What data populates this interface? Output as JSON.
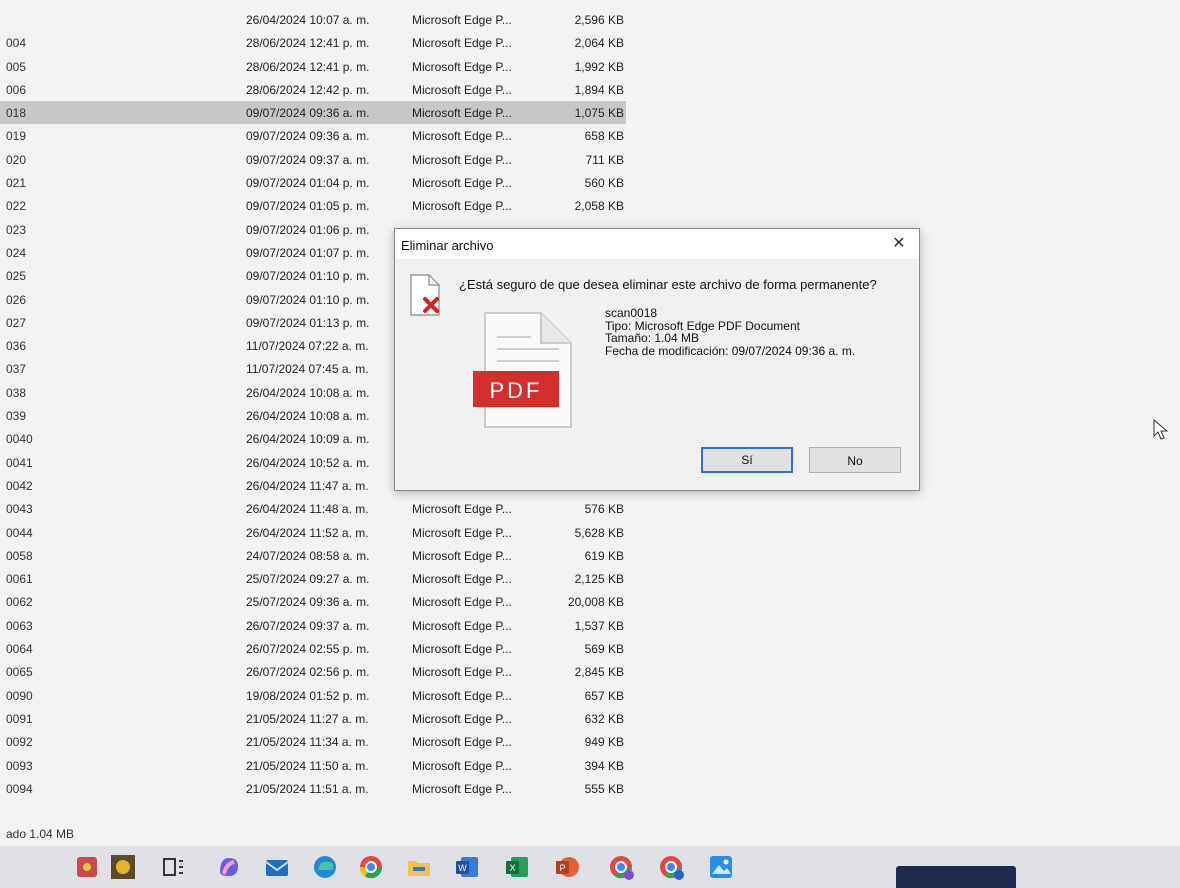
{
  "dialog": {
    "title": "Eliminar archivo",
    "close_glyph": "✕",
    "question": "¿Está seguro de que desea eliminar este archivo de forma permanente?",
    "file_name": "scan0018",
    "file_type": "Tipo: Microsoft Edge PDF Document",
    "file_size": "Tamaño: 1.04 MB",
    "file_modified": "Fecha de modificación: 09/07/2024 09:36 a. m.",
    "pdf_icon_label": "PDF",
    "yes_label": "Sí",
    "no_label": "No"
  },
  "files": [
    {
      "name": "",
      "date": "26/04/2024 10:07 a. m.",
      "type": "Microsoft Edge P...",
      "size": "2,596 KB"
    },
    {
      "name": "004",
      "date": "28/06/2024 12:41 p. m.",
      "type": "Microsoft Edge P...",
      "size": "2,064 KB"
    },
    {
      "name": "005",
      "date": "28/06/2024 12:41 p. m.",
      "type": "Microsoft Edge P...",
      "size": "1,992 KB"
    },
    {
      "name": "006",
      "date": "28/06/2024 12:42 p. m.",
      "type": "Microsoft Edge P...",
      "size": "1,894 KB"
    },
    {
      "name": "018",
      "date": "09/07/2024 09:36 a. m.",
      "type": "Microsoft Edge P...",
      "size": "1,075 KB",
      "selected": true
    },
    {
      "name": "019",
      "date": "09/07/2024 09:36 a. m.",
      "type": "Microsoft Edge P...",
      "size": "658 KB"
    },
    {
      "name": "020",
      "date": "09/07/2024 09:37 a. m.",
      "type": "Microsoft Edge P...",
      "size": "711 KB"
    },
    {
      "name": "021",
      "date": "09/07/2024 01:04 p. m.",
      "type": "Microsoft Edge P...",
      "size": "560 KB"
    },
    {
      "name": "022",
      "date": "09/07/2024 01:05 p. m.",
      "type": "Microsoft Edge P...",
      "size": "2,058 KB"
    },
    {
      "name": "023",
      "date": "09/07/2024 01:06 p. m.",
      "type": "",
      "size": ""
    },
    {
      "name": "024",
      "date": "09/07/2024 01:07 p. m.",
      "type": "",
      "size": ""
    },
    {
      "name": "025",
      "date": "09/07/2024 01:10 p. m.",
      "type": "",
      "size": ""
    },
    {
      "name": "026",
      "date": "09/07/2024 01:10 p. m.",
      "type": "",
      "size": ""
    },
    {
      "name": "027",
      "date": "09/07/2024 01:13 p. m.",
      "type": "",
      "size": ""
    },
    {
      "name": "036",
      "date": "11/07/2024 07:22 a. m.",
      "type": "",
      "size": ""
    },
    {
      "name": "037",
      "date": "11/07/2024 07:45 a. m.",
      "type": "",
      "size": ""
    },
    {
      "name": "038",
      "date": "26/04/2024 10:08 a. m.",
      "type": "",
      "size": ""
    },
    {
      "name": "039",
      "date": "26/04/2024 10:08 a. m.",
      "type": "",
      "size": ""
    },
    {
      "name": "0040",
      "date": "26/04/2024 10:09 a. m.",
      "type": "",
      "size": ""
    },
    {
      "name": "0041",
      "date": "26/04/2024 10:52 a. m.",
      "type": "",
      "size": ""
    },
    {
      "name": "0042",
      "date": "26/04/2024 11:47 a. m.",
      "type": "",
      "size": ""
    },
    {
      "name": "0043",
      "date": "26/04/2024 11:48 a. m.",
      "type": "Microsoft Edge P...",
      "size": "576 KB"
    },
    {
      "name": "0044",
      "date": "26/04/2024 11:52 a. m.",
      "type": "Microsoft Edge P...",
      "size": "5,628 KB"
    },
    {
      "name": "0058",
      "date": "24/07/2024 08:58 a. m.",
      "type": "Microsoft Edge P...",
      "size": "619 KB"
    },
    {
      "name": "0061",
      "date": "25/07/2024 09:27 a. m.",
      "type": "Microsoft Edge P...",
      "size": "2,125 KB"
    },
    {
      "name": "0062",
      "date": "25/07/2024 09:36 a. m.",
      "type": "Microsoft Edge P...",
      "size": "20,008 KB"
    },
    {
      "name": "0063",
      "date": "26/07/2024 09:37 a. m.",
      "type": "Microsoft Edge P...",
      "size": "1,537 KB"
    },
    {
      "name": "0064",
      "date": "26/07/2024 02:55 p. m.",
      "type": "Microsoft Edge P...",
      "size": "569 KB"
    },
    {
      "name": "0065",
      "date": "26/07/2024 02:56 p. m.",
      "type": "Microsoft Edge P...",
      "size": "2,845 KB"
    },
    {
      "name": "0090",
      "date": "19/08/2024 01:52 p. m.",
      "type": "Microsoft Edge P...",
      "size": "657 KB"
    },
    {
      "name": "0091",
      "date": "21/05/2024 11:27 a. m.",
      "type": "Microsoft Edge P...",
      "size": "632 KB"
    },
    {
      "name": "0092",
      "date": "21/05/2024 11:34 a. m.",
      "type": "Microsoft Edge P...",
      "size": "949 KB"
    },
    {
      "name": "0093",
      "date": "21/05/2024 11:50 a. m.",
      "type": "Microsoft Edge P...",
      "size": "394 KB"
    },
    {
      "name": "0094",
      "date": "21/05/2024 11:51 a. m.",
      "type": "Microsoft Edge P...",
      "size": "555 KB"
    }
  ],
  "status_bar": {
    "text": "ado 1.04 MB"
  },
  "taskbar": {
    "icons": [
      "chip-icon",
      "sun-icon",
      "task-view-icon",
      "copilot-icon",
      "mail-icon",
      "edge-icon",
      "chrome-icon",
      "file-explorer-icon",
      "word-icon",
      "excel-icon",
      "powerpoint-icon",
      "chrome-profile-icon",
      "chrome-profile-icon",
      "photos-icon"
    ]
  },
  "colors": {
    "selection": "#c7c7c7",
    "pdf_red": "#d32f2f",
    "delete_red": "#d42020",
    "yes_button_border": "#2f6fd6"
  }
}
